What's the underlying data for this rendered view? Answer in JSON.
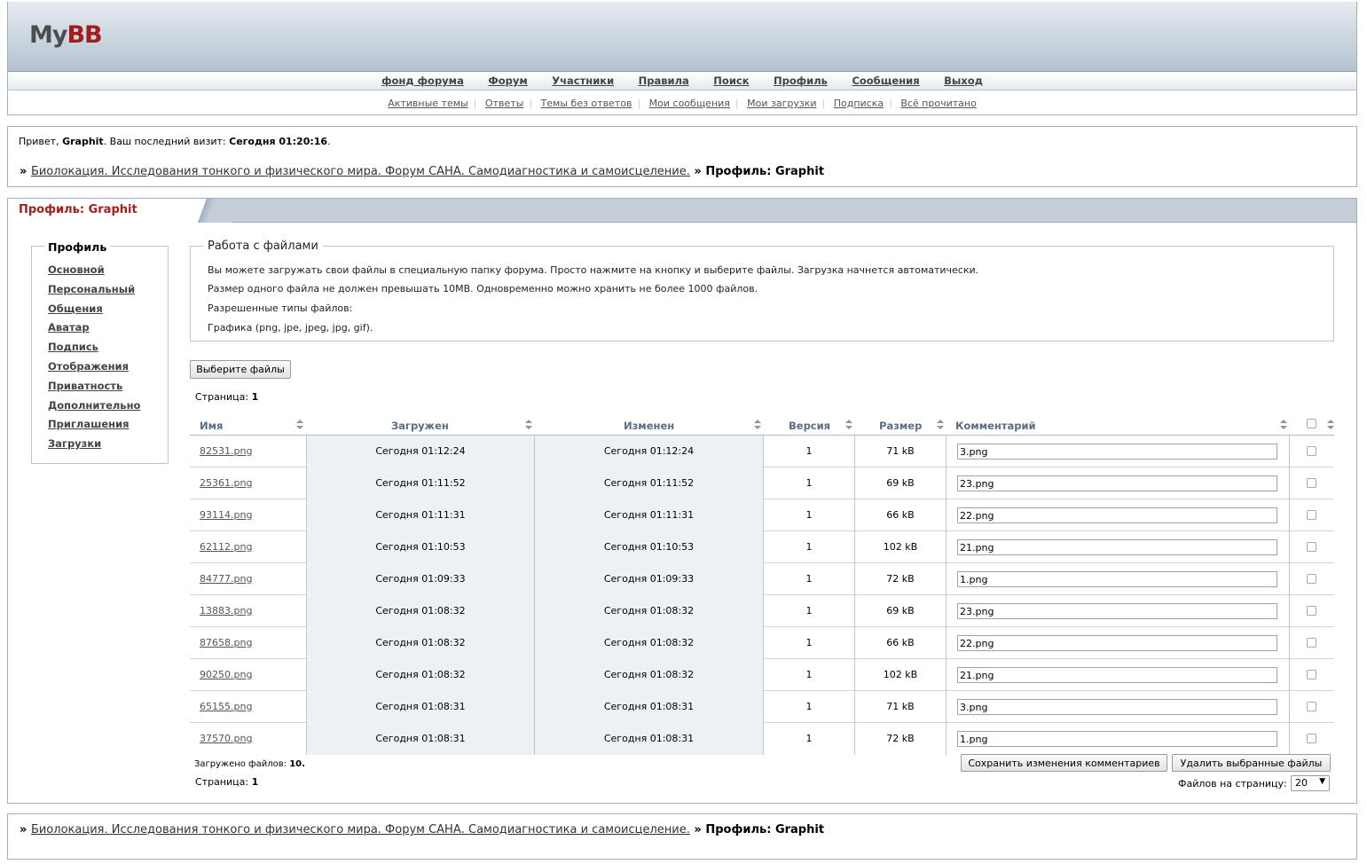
{
  "logo": {
    "my": "My",
    "bb": "BB"
  },
  "nav_main": [
    "фонд форума",
    "Форум",
    "Участники",
    "Правила",
    "Поиск",
    "Профиль",
    "Сообщения",
    "Выход"
  ],
  "nav_sub": [
    "Активные темы",
    "Ответы",
    "Темы без ответов",
    "Мои сообщения",
    "Мои загрузки",
    "Подписка",
    "Всё прочитано"
  ],
  "welcome": {
    "greeting": "Привет,",
    "username": "Graphit",
    "last_visit_label": ".  Ваш последний визит:",
    "last_visit_value": "Сегодня 01:20:16",
    "period": "."
  },
  "breadcrumb": {
    "sep": "»",
    "forum": "Биолокация. Исследования тонкого и физического мира. Форум САНА. Самодиагностика и самоисцеление.",
    "current": "Профиль: Graphit"
  },
  "profile_title": "Профиль: Graphit",
  "sidebar": {
    "title": "Профиль",
    "items": [
      "Основной",
      "Персональный",
      "Общения",
      "Аватар",
      "Подпись",
      "Отображения",
      "Приватность",
      "Дополнительно",
      "Приглашения",
      "Загрузки"
    ]
  },
  "files_info": {
    "title": "Работа с файлами",
    "line1": "Вы можете загружать свои файлы в специальную папку форума. Просто нажмите на кнопку и выберите файлы. Загрузка начнется автоматически.",
    "line2": "Размер одного файла не должен превышать 10MB. Одновременно можно хранить не более 1000 файлов.",
    "line3": "Разрешенные типы файлов:",
    "line4": "Графика (png, jpe, jpeg, jpg, gif)."
  },
  "choose_button": "Выберите файлы",
  "pager": {
    "label": "Страница:",
    "value": "1"
  },
  "table": {
    "headers": {
      "name": "Имя",
      "uploaded": "Загружен",
      "modified": "Изменен",
      "version": "Версия",
      "size": "Размер",
      "comment": "Комментарий"
    },
    "rows": [
      {
        "name": "82531.png",
        "uploaded": "Сегодня 01:12:24",
        "modified": "Сегодня 01:12:24",
        "version": "1",
        "size": "71 kB",
        "comment": "3.png"
      },
      {
        "name": "25361.png",
        "uploaded": "Сегодня 01:11:52",
        "modified": "Сегодня 01:11:52",
        "version": "1",
        "size": "69 kB",
        "comment": "23.png"
      },
      {
        "name": "93114.png",
        "uploaded": "Сегодня 01:11:31",
        "modified": "Сегодня 01:11:31",
        "version": "1",
        "size": "66 kB",
        "comment": "22.png"
      },
      {
        "name": "62112.png",
        "uploaded": "Сегодня 01:10:53",
        "modified": "Сегодня 01:10:53",
        "version": "1",
        "size": "102 kB",
        "comment": "21.png"
      },
      {
        "name": "84777.png",
        "uploaded": "Сегодня 01:09:33",
        "modified": "Сегодня 01:09:33",
        "version": "1",
        "size": "72 kB",
        "comment": "1.png"
      },
      {
        "name": "13883.png",
        "uploaded": "Сегодня 01:08:32",
        "modified": "Сегодня 01:08:32",
        "version": "1",
        "size": "69 kB",
        "comment": "23.png"
      },
      {
        "name": "87658.png",
        "uploaded": "Сегодня 01:08:32",
        "modified": "Сегодня 01:08:32",
        "version": "1",
        "size": "66 kB",
        "comment": "22.png"
      },
      {
        "name": "90250.png",
        "uploaded": "Сегодня 01:08:32",
        "modified": "Сегодня 01:08:32",
        "version": "1",
        "size": "102 kB",
        "comment": "21.png"
      },
      {
        "name": "65155.png",
        "uploaded": "Сегодня 01:08:31",
        "modified": "Сегодня 01:08:31",
        "version": "1",
        "size": "71 kB",
        "comment": "3.png"
      },
      {
        "name": "37570.png",
        "uploaded": "Сегодня 01:08:31",
        "modified": "Сегодня 01:08:31",
        "version": "1",
        "size": "72 kB",
        "comment": "1.png"
      }
    ]
  },
  "uploaded": {
    "label": "Загружено файлов:",
    "value": "10."
  },
  "save_button": "Сохранить изменения комментариев",
  "delete_button": "Удалить выбранные файлы",
  "per_page": {
    "label": "Файлов на страницу:",
    "value": "20"
  }
}
